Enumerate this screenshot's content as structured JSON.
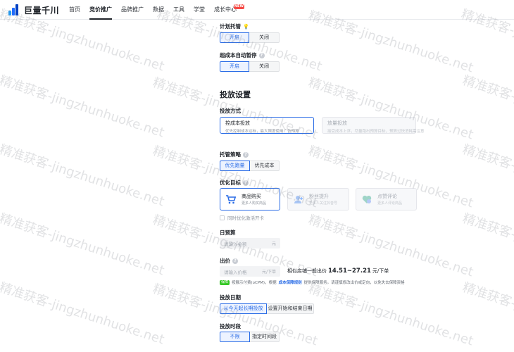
{
  "header": {
    "logo_text": "巨量千川",
    "nav": [
      {
        "label": "首页",
        "active": false,
        "badge": ""
      },
      {
        "label": "竞价推广",
        "active": true,
        "badge": ""
      },
      {
        "label": "品牌推广",
        "active": false,
        "badge": ""
      },
      {
        "label": "数据",
        "active": false,
        "badge": ""
      },
      {
        "label": "工具",
        "active": false,
        "badge": ""
      },
      {
        "label": "学堂",
        "active": false,
        "badge": ""
      },
      {
        "label": "成长中心",
        "active": false,
        "badge": "NEW"
      }
    ]
  },
  "plan_hosting": {
    "label": "计划托管",
    "on": "开启",
    "off": "关闭",
    "selected": "开启"
  },
  "auto_pause": {
    "label": "超成本自动暂停",
    "on": "开启",
    "off": "关闭",
    "selected": "开启"
  },
  "delivery": {
    "section_title": "投放设置",
    "method_label": "投放方式",
    "methods": [
      {
        "title": "控成本投放",
        "desc": "优先控制成本达标，最大限度使用广告预算",
        "selected": true
      },
      {
        "title": "放量投放",
        "desc": "接受成本上浮，尽量跑出预算目标，预算过快消耗需注意",
        "selected": false
      }
    ]
  },
  "strategy": {
    "label": "托管策略",
    "options": [
      "优先跑量",
      "优先成本"
    ],
    "selected": "优先跑量"
  },
  "goal": {
    "label": "优化目标",
    "options": [
      {
        "title": "商品购买",
        "desc": "更多人购买商品",
        "icon": "cart-icon",
        "selected": true
      },
      {
        "title": "粉丝提升",
        "desc": "更多人关注抖音号",
        "icon": "user-plus-icon",
        "selected": false
      },
      {
        "title": "点赞评论",
        "desc": "更多人评论商品",
        "icon": "heart-icon",
        "selected": false
      }
    ],
    "checkbox_label": "同时优化激活开卡"
  },
  "budget": {
    "label": "日预算",
    "placeholder": "请输入金额",
    "unit": "元"
  },
  "bid": {
    "label": "出价",
    "placeholder": "请输入价格",
    "unit": "元/下单",
    "similar_prefix": "相似店铺一般出价",
    "similar_range": "14.51~27.21",
    "similar_unit": "元/下单",
    "note_badge": "保障",
    "note_text_1": "按展示付费(oCPM)，根据",
    "note_link": "成本保障规则",
    "note_text_2": "提供保障服务。请谨慎修改出价或定向，以免失去保障资格"
  },
  "date": {
    "label": "投放日期",
    "options": [
      "从今天起长期投放",
      "设置开始和结束日期"
    ],
    "selected": "从今天起长期投放"
  },
  "period": {
    "label": "投放时段",
    "options": [
      "不限",
      "指定时间段"
    ],
    "selected": "不限"
  },
  "watermark": "精准获客-jingzhunhuoke.net",
  "colors": {
    "accent": "#2a6ce6",
    "badge": "#f54a45",
    "guarantee": "#34c724"
  }
}
